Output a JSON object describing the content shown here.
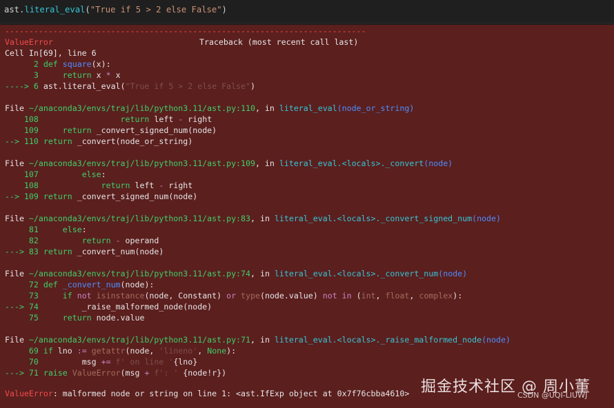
{
  "input": {
    "code_obj": "ast",
    "code_dot": ".",
    "code_func": "literal_eval",
    "code_open": "(",
    "code_str": "\"True if 5 > 2 else False\"",
    "code_close": ")"
  },
  "output": {
    "dashes": "---------------------------------------------------------------------------",
    "error_name": "ValueError",
    "traceback_header": "Traceback (most recent call last)",
    "cell_info": "Cell In[69], line 6",
    "block1": {
      "l2_num": "      2 ",
      "l2_kw": "def",
      "l2_fn": " square",
      "l2_rest": "(x):",
      "l3_num": "      3     ",
      "l3_kw": "return",
      "l3_rest": " x ",
      "l3_op": "*",
      "l3_rest2": " x",
      "arrow": "----> 6 ",
      "l6_code": "ast.literal_eval(",
      "l6_str": "\"True if 5 > 2 else False\"",
      "l6_close": ")"
    },
    "frame1": {
      "file_prefix": "File ",
      "file_path": "~/anaconda3/envs/traj/lib/python3.11/ast.py:110",
      "in_text": ", in ",
      "func": "literal_eval",
      "args": "(node_or_string)",
      "a_num": "    108                 ",
      "a_kw": "return",
      "a_rest1": " left ",
      "a_op": "-",
      "a_rest2": " right",
      "b_num": "    109     ",
      "b_kw": "return",
      "b_rest": " _convert_signed_num(node)",
      "c_arrow": "--> 110 ",
      "c_kw": "return",
      "c_rest": " _convert(node_or_string)"
    },
    "frame2": {
      "file_prefix": "File ",
      "file_path": "~/anaconda3/envs/traj/lib/python3.11/ast.py:109",
      "in_text": ", in ",
      "func": "literal_eval.<locals>._convert",
      "args": "(node)",
      "a_num": "    107         ",
      "a_kw": "else",
      "a_rest": ":",
      "b_num": "    108             ",
      "b_kw": "return",
      "b_rest1": " left ",
      "b_op": "-",
      "b_rest2": " right",
      "c_arrow": "--> 109 ",
      "c_kw": "return",
      "c_rest": " _convert_signed_num(node)"
    },
    "frame3": {
      "file_prefix": "File ",
      "file_path": "~/anaconda3/envs/traj/lib/python3.11/ast.py:83",
      "in_text": ", in ",
      "func": "literal_eval.<locals>._convert_signed_num",
      "args": "(node)",
      "a_num": "     81     ",
      "a_kw": "else",
      "a_rest": ":",
      "b_num": "     82         ",
      "b_kw": "return",
      "b_rest1": " ",
      "b_op": "-",
      "b_rest2": " operand",
      "c_arrow": "---> 83 ",
      "c_kw": "return",
      "c_rest": " _convert_num(node)"
    },
    "frame4": {
      "file_prefix": "File ",
      "file_path": "~/anaconda3/envs/traj/lib/python3.11/ast.py:74",
      "in_text": ", in ",
      "func": "literal_eval.<locals>._convert_num",
      "args": "(node)",
      "a_num": "     72 ",
      "a_kw": "def",
      "a_fn": " _convert_num",
      "a_rest": "(node):",
      "b_num": "     73     ",
      "b_kw": "if",
      "b_kw2": " not",
      "b_builtin": " isinstance",
      "b_rest1": "(node, Constant) ",
      "b_or": "or",
      "b_type": " type",
      "b_rest2": "(node.value) ",
      "b_notin": "not in",
      "b_rest3": " (",
      "b_int": "int",
      "b_c1": ", ",
      "b_float": "float",
      "b_c2": ", ",
      "b_complex": "complex",
      "b_rest4": "):",
      "c_arrow": "---> 74 ",
      "c_rest": "        _raise_malformed_node(node)",
      "d_num": "     75     ",
      "d_kw": "return",
      "d_rest": " node.value"
    },
    "frame5": {
      "file_prefix": "File ",
      "file_path": "~/anaconda3/envs/traj/lib/python3.11/ast.py:71",
      "in_text": ", in ",
      "func": "literal_eval.<locals>._raise_malformed_node",
      "args": "(node)",
      "a_num": "     69 ",
      "a_kw": "if",
      "a_rest1": " lno ",
      "a_op": ":=",
      "a_builtin": " getattr",
      "a_rest2": "(node, ",
      "a_str": "'lineno'",
      "a_rest3": ", ",
      "a_none": "None",
      "a_rest4": "):",
      "b_num": "     70         ",
      "b_rest1": "msg ",
      "b_op": "+=",
      "b_str": " f' on line '",
      "b_rest2": "{lno}",
      "c_arrow": "---> 71 ",
      "c_kw": "raise",
      "c_err": " ValueError",
      "c_rest1": "(msg ",
      "c_op": "+",
      "c_str": " f': '",
      "c_rest2": " {node!r})"
    },
    "final_error_name": "ValueError",
    "final_message": ": malformed node or string on line 1: <ast.IfExp object at 0x7f76cbba4610>"
  },
  "watermark": {
    "main": "掘金技术社区 @ 周小董",
    "sub": "CSDN @UQI-LIUWJ"
  }
}
